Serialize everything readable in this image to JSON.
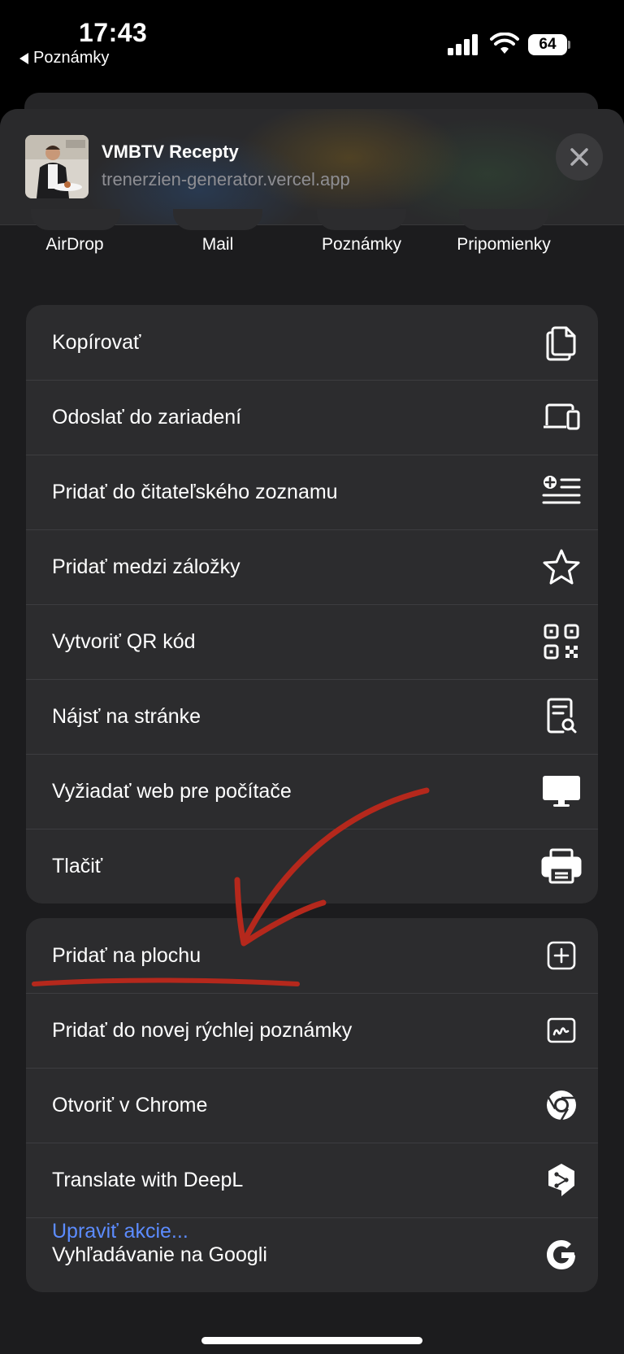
{
  "status_bar": {
    "time": "17:43",
    "back_label": "Poznámky",
    "battery": "64"
  },
  "header": {
    "title": "VMBTV Recepty",
    "url": "trenerzien-generator.vercel.app"
  },
  "share_targets": [
    {
      "label": "AirDrop"
    },
    {
      "label": "Mail"
    },
    {
      "label": "Poznámky"
    },
    {
      "label": "Pripomienky"
    }
  ],
  "group1": [
    {
      "label": "Kopírovať",
      "icon": "copy-icon"
    },
    {
      "label": "Odoslať do zariadení",
      "icon": "devices-icon"
    },
    {
      "label": "Pridať do čitateľského zoznamu",
      "icon": "reading-list-icon"
    },
    {
      "label": "Pridať medzi záložky",
      "icon": "star-icon"
    },
    {
      "label": "Vytvoriť QR kód",
      "icon": "qr-code-icon"
    },
    {
      "label": "Nájsť na stránke",
      "icon": "find-on-page-icon"
    },
    {
      "label": "Vyžiadať web pre počítače",
      "icon": "desktop-icon"
    },
    {
      "label": "Tlačiť",
      "icon": "printer-icon"
    }
  ],
  "group2": [
    {
      "label": "Pridať na plochu",
      "icon": "add-to-home-icon"
    },
    {
      "label": "Pridať do novej rýchlej poznámky",
      "icon": "quick-note-icon"
    },
    {
      "label": "Otvoriť v Chrome",
      "icon": "chrome-icon"
    },
    {
      "label": "Translate with DeepL",
      "icon": "deepl-icon"
    },
    {
      "label": "Vyhľadávanie na Googli",
      "icon": "google-icon"
    }
  ],
  "edit_actions_label": "Upraviť akcie...",
  "colors": {
    "sheet_bg": "#1c1c1e",
    "group_bg": "#2c2c2e",
    "link": "#5c8cff",
    "annotation": "#b5281c"
  }
}
